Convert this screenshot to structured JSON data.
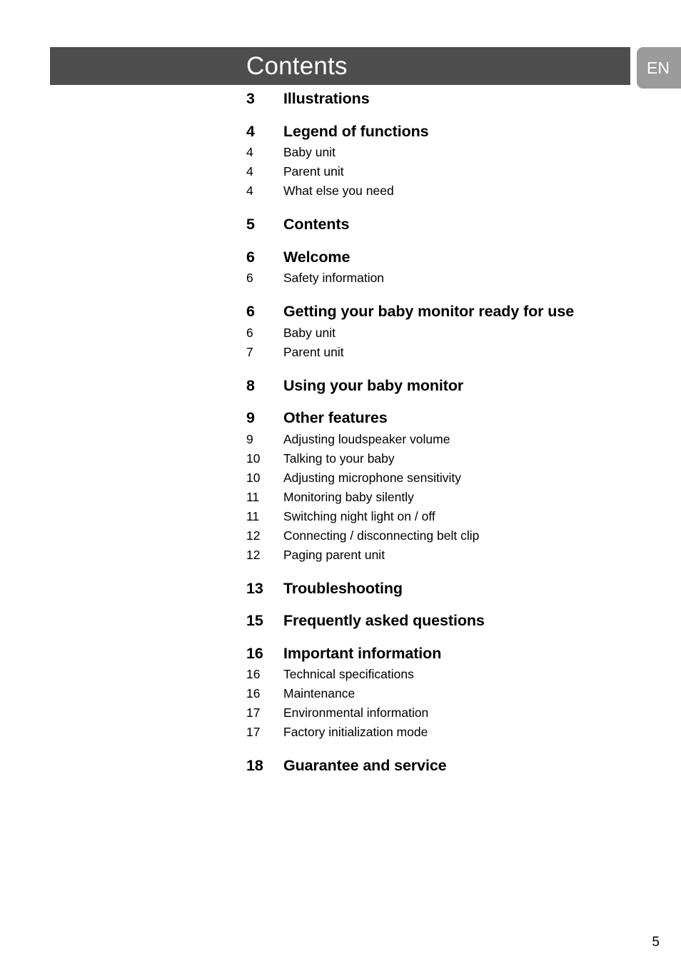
{
  "header": {
    "title": "Contents",
    "language_tab": "EN"
  },
  "toc": {
    "entries": [
      {
        "kind": "chapter",
        "page": "3",
        "title": "Illustrations"
      },
      {
        "kind": "chapter",
        "page": "4",
        "title": "Legend of functions"
      },
      {
        "kind": "sub",
        "page": "4",
        "title": "Baby unit"
      },
      {
        "kind": "sub",
        "page": "4",
        "title": "Parent unit"
      },
      {
        "kind": "sub",
        "page": "4",
        "title": "What else you need"
      },
      {
        "kind": "chapter",
        "page": "5",
        "title": "Contents"
      },
      {
        "kind": "chapter",
        "page": "6",
        "title": "Welcome"
      },
      {
        "kind": "sub",
        "page": "6",
        "title": "Safety information"
      },
      {
        "kind": "chapter",
        "page": "6",
        "title": "Getting your baby monitor ready for use"
      },
      {
        "kind": "sub",
        "page": "6",
        "title": "Baby unit"
      },
      {
        "kind": "sub",
        "page": "7",
        "title": "Parent unit"
      },
      {
        "kind": "chapter",
        "page": "8",
        "title": "Using your baby monitor"
      },
      {
        "kind": "chapter",
        "page": "9",
        "title": "Other features"
      },
      {
        "kind": "sub",
        "page": "9",
        "title": "Adjusting loudspeaker volume"
      },
      {
        "kind": "sub",
        "page": "10",
        "title": "Talking to your baby"
      },
      {
        "kind": "sub",
        "page": "10",
        "title": "Adjusting microphone sensitivity"
      },
      {
        "kind": "sub",
        "page": "11",
        "title": "Monitoring baby silently"
      },
      {
        "kind": "sub",
        "page": "11",
        "title": "Switching night light on / off"
      },
      {
        "kind": "sub",
        "page": "12",
        "title": "Connecting / disconnecting belt clip"
      },
      {
        "kind": "sub",
        "page": "12",
        "title": "Paging parent unit"
      },
      {
        "kind": "chapter",
        "page": "13",
        "title": "Troubleshooting"
      },
      {
        "kind": "chapter",
        "page": "15",
        "title": "Frequently asked questions"
      },
      {
        "kind": "chapter",
        "page": "16",
        "title": "Important information"
      },
      {
        "kind": "sub",
        "page": "16",
        "title": "Technical specifications"
      },
      {
        "kind": "sub",
        "page": "16",
        "title": "Maintenance"
      },
      {
        "kind": "sub",
        "page": "17",
        "title": "Environmental information"
      },
      {
        "kind": "sub",
        "page": "17",
        "title": "Factory initialization mode"
      },
      {
        "kind": "chapter",
        "page": "18",
        "title": "Guarantee and service"
      }
    ]
  },
  "footer": {
    "page_number": "5"
  },
  "colors": {
    "header_bar": "#4e4e4e",
    "language_tab": "#9b9b9b",
    "text": "#000000",
    "page_background": "#ffffff"
  }
}
